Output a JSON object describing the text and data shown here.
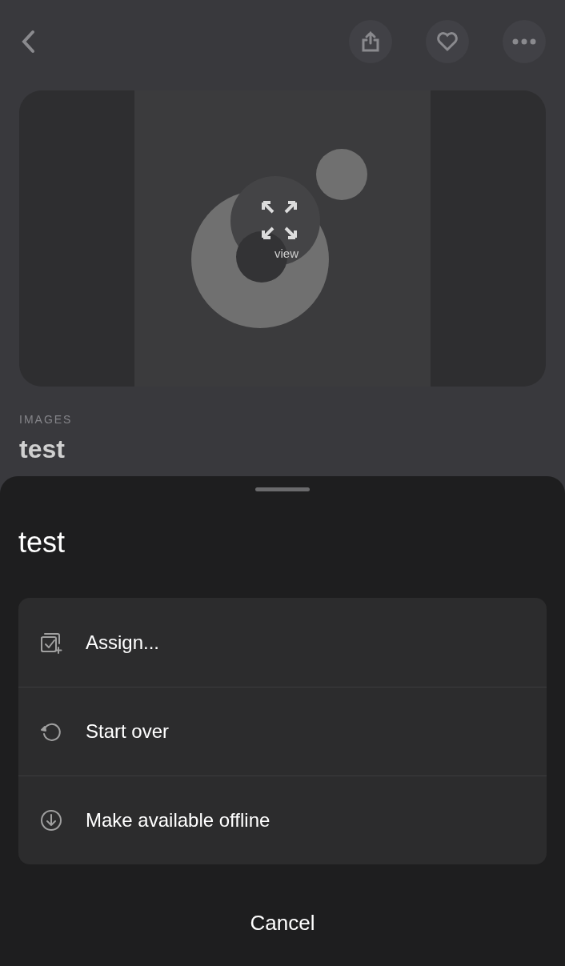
{
  "background_screen": {
    "preview": {
      "view_label": "view"
    },
    "category": "IMAGES",
    "title": "test"
  },
  "sheet": {
    "title": "test",
    "actions": [
      {
        "kind": "assign",
        "label": "Assign..."
      },
      {
        "kind": "restart",
        "label": "Start over"
      },
      {
        "kind": "download",
        "label": "Make available offline"
      }
    ],
    "cancel": "Cancel"
  }
}
